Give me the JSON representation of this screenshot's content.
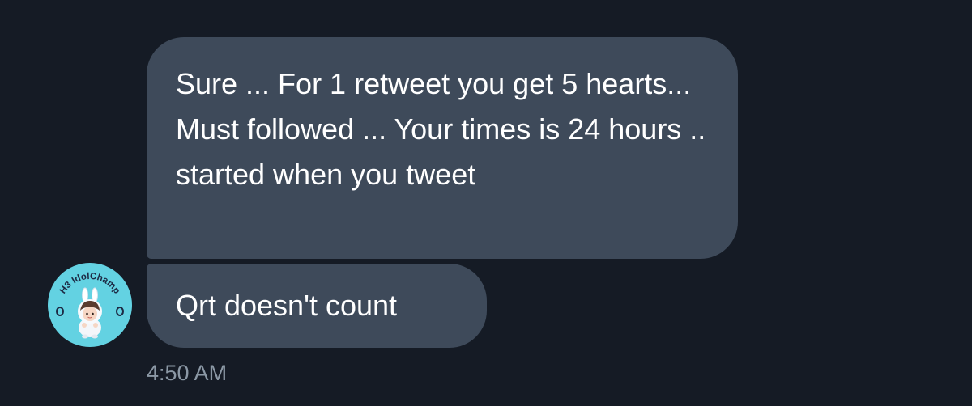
{
  "conversation": {
    "messages": [
      {
        "text": "Sure ... For 1 retweet you get 5 hearts... Must followed ... Your times is 24 hours .. started when you tweet"
      },
      {
        "text": "Qrt doesn't count"
      }
    ],
    "timestamp": "4:50 AM"
  },
  "avatar": {
    "logo_text": "H3 IdolChamp",
    "background_color": "#63d2e2"
  },
  "colors": {
    "background": "#151b25",
    "bubble": "#3e4a5a",
    "text": "#ffffff",
    "timestamp": "#8b98a5"
  }
}
